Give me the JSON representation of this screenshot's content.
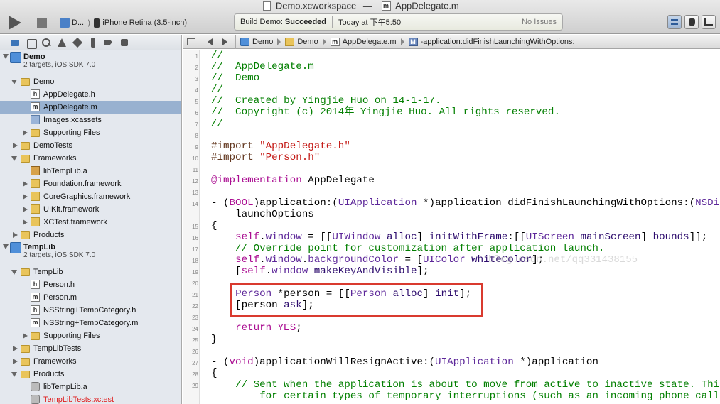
{
  "window": {
    "workspace": "Demo.xcworkspace",
    "separator": "—",
    "current_file": "AppDelegate.m"
  },
  "toolbar": {
    "scheme_app": "D...",
    "scheme_device": "iPhone Retina (3.5-inch)",
    "activity_prefix": "Build Demo:",
    "activity_status": "Succeeded",
    "activity_time": "Today at 下午5:50",
    "activity_issues": "No Issues"
  },
  "navigator": {
    "rows": [
      {
        "label": "Demo",
        "sub": "2 targets, iOS SDK 7.0"
      },
      {
        "label": "Demo"
      },
      {
        "label": "AppDelegate.h"
      },
      {
        "label": "AppDelegate.m"
      },
      {
        "label": "Images.xcassets"
      },
      {
        "label": "Supporting Files"
      },
      {
        "label": "DemoTests"
      },
      {
        "label": "Frameworks"
      },
      {
        "label": "libTempLib.a"
      },
      {
        "label": "Foundation.framework"
      },
      {
        "label": "CoreGraphics.framework"
      },
      {
        "label": "UIKit.framework"
      },
      {
        "label": "XCTest.framework"
      },
      {
        "label": "Products"
      },
      {
        "label": "TempLib",
        "sub": "2 targets, iOS SDK 7.0"
      },
      {
        "label": "TempLib"
      },
      {
        "label": "Person.h"
      },
      {
        "label": "Person.m"
      },
      {
        "label": "NSString+TempCategory.h"
      },
      {
        "label": "NSString+TempCategory.m"
      },
      {
        "label": "Supporting Files"
      },
      {
        "label": "TempLibTests"
      },
      {
        "label": "Frameworks"
      },
      {
        "label": "Products"
      },
      {
        "label": "libTempLib.a"
      },
      {
        "label": "TempLibTests.xctest"
      }
    ]
  },
  "jumpbar": {
    "crumbs": [
      "Demo",
      "Demo",
      "AppDelegate.m",
      "-application:didFinishLaunchingWithOptions:"
    ]
  },
  "editor": {
    "line_numbers": [
      "1",
      "2",
      "3",
      "4",
      "5",
      "6",
      "7",
      "8",
      "9",
      "10",
      "11",
      "12",
      "13",
      "14",
      "",
      "15",
      "16",
      "17",
      "18",
      "19",
      "20",
      "21",
      "22",
      "23",
      "24",
      "25",
      "26",
      "27",
      "28",
      "29",
      ""
    ],
    "watermark": "blog.csdn.net/qq331438155"
  }
}
